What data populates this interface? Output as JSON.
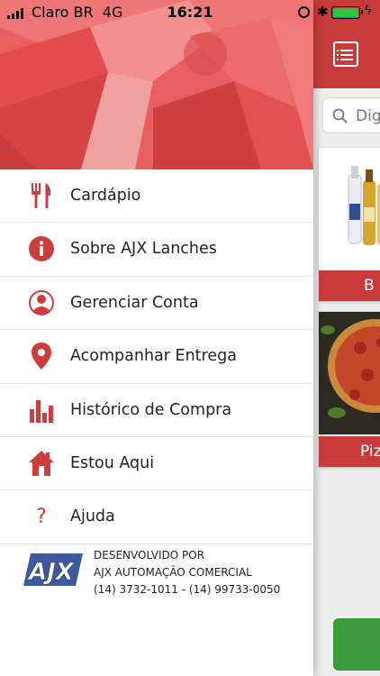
{
  "status_bar": {
    "carrier": "Claro BR",
    "network": "4G",
    "time": "16:21"
  },
  "menu": {
    "items": [
      {
        "label": "Cardápio",
        "icon": "fork-knife-icon"
      },
      {
        "label": "Sobre AJX Lanches",
        "icon": "info-icon"
      },
      {
        "label": "Gerenciar Conta",
        "icon": "user-icon"
      },
      {
        "label": "Acompanhar Entrega",
        "icon": "map-pin-icon"
      },
      {
        "label": "Histórico de Compra",
        "icon": "bar-chart-icon"
      },
      {
        "label": "Estou Aqui",
        "icon": "home-icon"
      },
      {
        "label": "Ajuda",
        "icon": "question-icon"
      }
    ]
  },
  "footer": {
    "logo_text": "AJX",
    "line1": "DESENVOLVIDO POR",
    "line2": "AJX AUTOMAÇÃO COMERCIAL",
    "phones": "(14) 3732-1011 - (14) 99733-0050"
  },
  "background_app": {
    "search_placeholder": "Digi",
    "cards": [
      {
        "caption": "B"
      },
      {
        "caption": "Piz"
      }
    ]
  },
  "colors": {
    "brand_red": "#c93a3b",
    "icon_red": "#cc3d3d",
    "green_button": "#3a9a3e"
  }
}
